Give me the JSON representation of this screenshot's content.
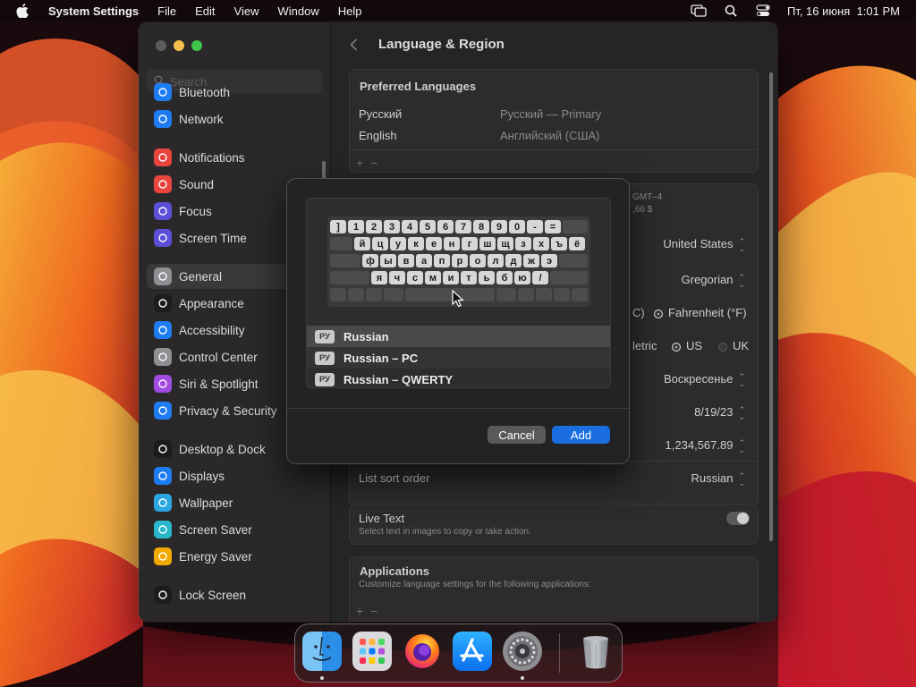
{
  "menubar": {
    "app_name": "System Settings",
    "menus": [
      "File",
      "Edit",
      "View",
      "Window",
      "Help"
    ],
    "clock": "Пт, 16 июня  1:01 PM",
    "icons": [
      "apple-icon",
      "screen-mirroring-icon",
      "spotlight-search-icon",
      "control-center-icon"
    ]
  },
  "sidebar": {
    "search_placeholder": "Search",
    "items": [
      {
        "label": "Bluetooth",
        "icon": "bluetooth-icon",
        "color": "#1e7cf2"
      },
      {
        "label": "Network",
        "icon": "globe-icon",
        "color": "#1e7cf2"
      },
      {
        "label": "Notifications",
        "icon": "bell-icon",
        "color": "#e8453c"
      },
      {
        "label": "Sound",
        "icon": "speaker-icon",
        "color": "#e8453c"
      },
      {
        "label": "Focus",
        "icon": "moon-icon",
        "color": "#5b4fd8"
      },
      {
        "label": "Screen Time",
        "icon": "hourglass-icon",
        "color": "#5b4fd8"
      },
      {
        "label": "General",
        "icon": "gear-icon",
        "color": "#8e8e93"
      },
      {
        "label": "Appearance",
        "icon": "appearance-icon",
        "color": "#1c1c1e"
      },
      {
        "label": "Accessibility",
        "icon": "accessibility-icon",
        "color": "#1e7cf2"
      },
      {
        "label": "Control Center",
        "icon": "control-center-icon",
        "color": "#8e8e93"
      },
      {
        "label": "Siri & Spotlight",
        "icon": "siri-icon",
        "color": "#a14be0"
      },
      {
        "label": "Privacy & Security",
        "icon": "hand-icon",
        "color": "#1e7cf2"
      },
      {
        "label": "Desktop & Dock",
        "icon": "dock-icon",
        "color": "#1c1c1e"
      },
      {
        "label": "Displays",
        "icon": "sun-icon",
        "color": "#1e7cf2"
      },
      {
        "label": "Wallpaper",
        "icon": "wallpaper-icon",
        "color": "#2aa6e0"
      },
      {
        "label": "Screen Saver",
        "icon": "screensaver-icon",
        "color": "#2ab7c9"
      },
      {
        "label": "Energy Saver",
        "icon": "battery-icon",
        "color": "#f2a900"
      },
      {
        "label": "Lock Screen",
        "icon": "lock-icon",
        "color": "#1c1c1e"
      }
    ]
  },
  "main": {
    "title": "Language & Region",
    "preferred_languages": {
      "title": "Preferred Languages",
      "rows": [
        {
          "name": "Русский",
          "detail": "Русский — Primary"
        },
        {
          "name": "English",
          "detail": "Английский (США)"
        }
      ]
    },
    "partial_timezone": "GMT–4",
    "partial_currency": ",66 $",
    "region_value": "United States",
    "calendar_value": "Gregorian",
    "temperature": {
      "celsius_partial": "C)",
      "fahrenheit": "Fahrenheit (°F)"
    },
    "measurement": {
      "metric_partial": "letric",
      "us": "US",
      "uk": "UK"
    },
    "first_day_value": "Воскресенье",
    "date_format_value": "8/19/23",
    "number_format_value": "1,234,567.89",
    "list_sort": {
      "label": "List sort order",
      "value": "Russian"
    },
    "live_text": {
      "label": "Live Text",
      "description": "Select text in images to copy or take action."
    },
    "applications": {
      "title": "Applications",
      "description": "Customize language settings for the following applications:"
    }
  },
  "sheet": {
    "keyboard_rows": [
      [
        "]",
        "1",
        "2",
        "3",
        "4",
        "5",
        "6",
        "7",
        "8",
        "9",
        "0",
        "-",
        "="
      ],
      [
        "й",
        "ц",
        "у",
        "к",
        "е",
        "н",
        "г",
        "ш",
        "щ",
        "з",
        "х",
        "ъ",
        "ё"
      ],
      [
        "ф",
        "ы",
        "в",
        "а",
        "п",
        "р",
        "о",
        "л",
        "д",
        "ж",
        "э"
      ],
      [
        "я",
        "ч",
        "с",
        "м",
        "и",
        "т",
        "ь",
        "б",
        "ю",
        "/"
      ]
    ],
    "layouts": [
      {
        "badge": "РУ",
        "name": "Russian"
      },
      {
        "badge": "РУ",
        "name": "Russian – PC"
      },
      {
        "badge": "РУ",
        "name": "Russian – QWERTY"
      }
    ],
    "cancel_label": "Cancel",
    "add_label": "Add"
  },
  "dock": {
    "apps": [
      "finder-icon",
      "launchpad-icon",
      "firefox-icon",
      "app-store-icon",
      "system-settings-icon",
      "trash-icon"
    ]
  }
}
